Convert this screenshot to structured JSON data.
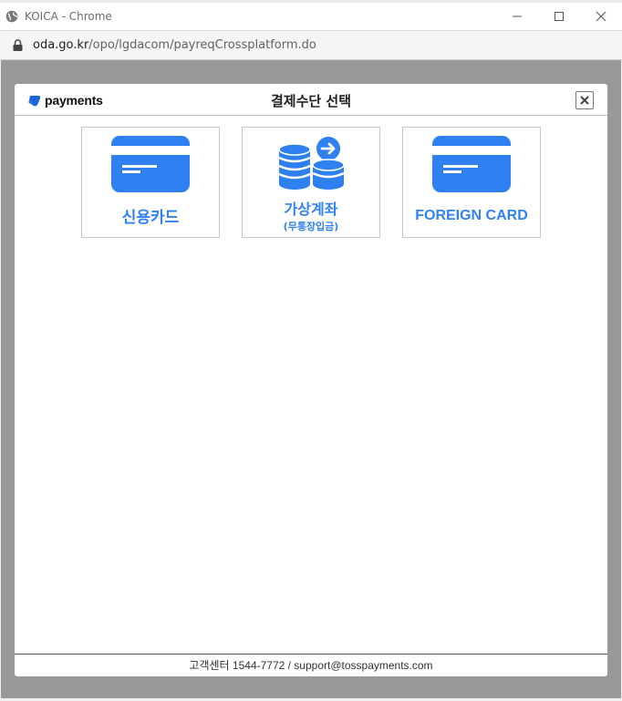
{
  "window": {
    "title": "KOICA - Chrome"
  },
  "address": {
    "domain": "oda.go.kr",
    "path": "/opo/lgdacom/payreqCrossplatform.do"
  },
  "modal": {
    "brand": "payments",
    "title": "결제수단 선택",
    "options": [
      {
        "label": "신용카드",
        "sublabel": ""
      },
      {
        "label": "가상계좌",
        "sublabel": "(무통장입금)"
      },
      {
        "label": "FOREIGN CARD",
        "sublabel": ""
      }
    ],
    "footer": "고객센터 1544-7772 / support@tosspayments.com"
  },
  "colors": {
    "accent": "#3182f6",
    "overlay": "#999999",
    "icon_blue": "#2f80f0"
  }
}
